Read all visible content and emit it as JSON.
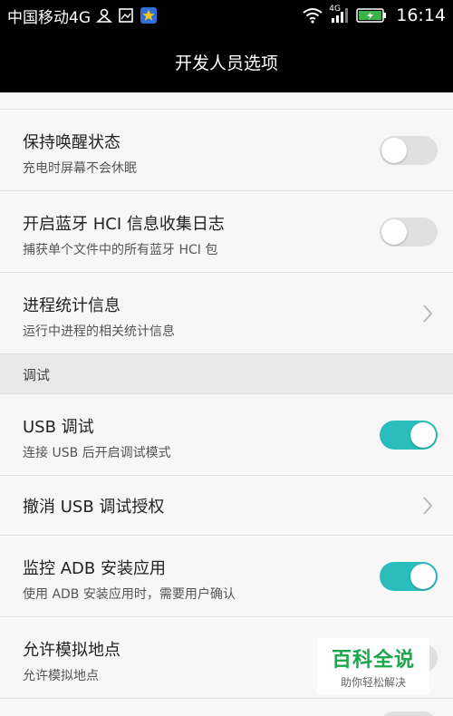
{
  "status_bar": {
    "carrier": "中国移动4G",
    "network_label": "4G",
    "time": "16:14"
  },
  "title": "开发人员选项",
  "items": [
    {
      "title": "保持唤醒状态",
      "subtitle": "充电时屏幕不会休眠",
      "toggle_on": false
    },
    {
      "title": "开启蓝牙 HCI 信息收集日志",
      "subtitle": "捕获单个文件中的所有蓝牙 HCI 包",
      "toggle_on": false
    },
    {
      "title": "进程统计信息",
      "subtitle": "运行中进程的相关统计信息"
    }
  ],
  "section_header": "调试",
  "debug_items": [
    {
      "title": "USB 调试",
      "subtitle": "连接 USB 后开启调试模式",
      "toggle_on": true
    },
    {
      "title": "撤消 USB 调试授权"
    },
    {
      "title": "监控 ADB 安装应用",
      "subtitle": "使用 ADB 安装应用时，需要用户确认",
      "toggle_on": true
    },
    {
      "title": "允许模拟地点",
      "subtitle": "允许模拟地点",
      "toggle_on": false
    }
  ],
  "watermark": {
    "main": "百科全说",
    "sub": "助你轻松解决"
  },
  "colors": {
    "accent": "#2abdbb",
    "toggle_off": "#e0e0e0",
    "watermark": "#1aa64a"
  }
}
